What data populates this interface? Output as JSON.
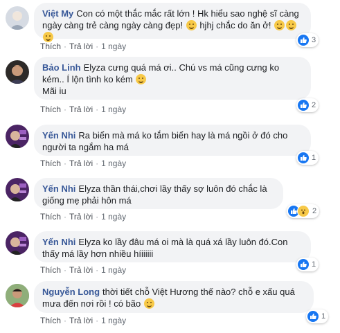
{
  "actions": {
    "like": "Thích",
    "reply": "Trả lời",
    "separator": "·"
  },
  "comments": [
    {
      "name": "Việt My",
      "text": "Con có một thắc mắc rất lớn ! Hk hiểu sao nghệ sĩ càng ngày càng trẻ càng ngày càng đẹp! ",
      "text_after": " hjhj chắc do ăn ở! ",
      "time": "1 ngày",
      "reaction_count": "3",
      "avatar_color": "#c9cfd8"
    },
    {
      "name": "Bảo Linh",
      "text": "Elyza cưng quá má ơi.. Chú vs má cũng cưng ko kém.. Í lộn tình ko kém ",
      "text_line2": "Mãi iu",
      "time": "1 ngày",
      "reaction_count": "2",
      "avatar_color": "#4a3a2e"
    },
    {
      "name": "Yến Nhi",
      "text": "Ra biển mà má ko tắm biển hay là má ngồi ở đó cho người ta ngắm ha má",
      "time": "1 ngày",
      "reaction_count": "1",
      "avatar_color": "#5a2d6e"
    },
    {
      "name": "Yến Nhi",
      "text": "Elyza thần thái,chơi lầy thấy sợ luôn đó chắc là giống mẹ phải hôn má",
      "time": "1 ngày",
      "reaction_count": "2",
      "avatar_color": "#5a2d6e"
    },
    {
      "name": "Yến Nhi",
      "text": "Elyza ko lầy đâu má oi mà là quá xá lầy luôn đó.Con thấy má lầy hơn nhiều híiiiiii",
      "time": "1 ngày",
      "reaction_count": "1",
      "avatar_color": "#5a2d6e"
    },
    {
      "name": "Nguyễn Long",
      "text": "thời tiết chỗ Việt Hương thế nào? chỗ e xấu quá mưa đến nơi rồi ! có bão ",
      "time": "1 ngày",
      "reaction_count": "1",
      "avatar_color": "#3f6b3a"
    }
  ],
  "colors": {
    "name": "#385898",
    "bubble": "#f2f3f5",
    "like": "#1877f2",
    "wow": "#f7c948"
  }
}
